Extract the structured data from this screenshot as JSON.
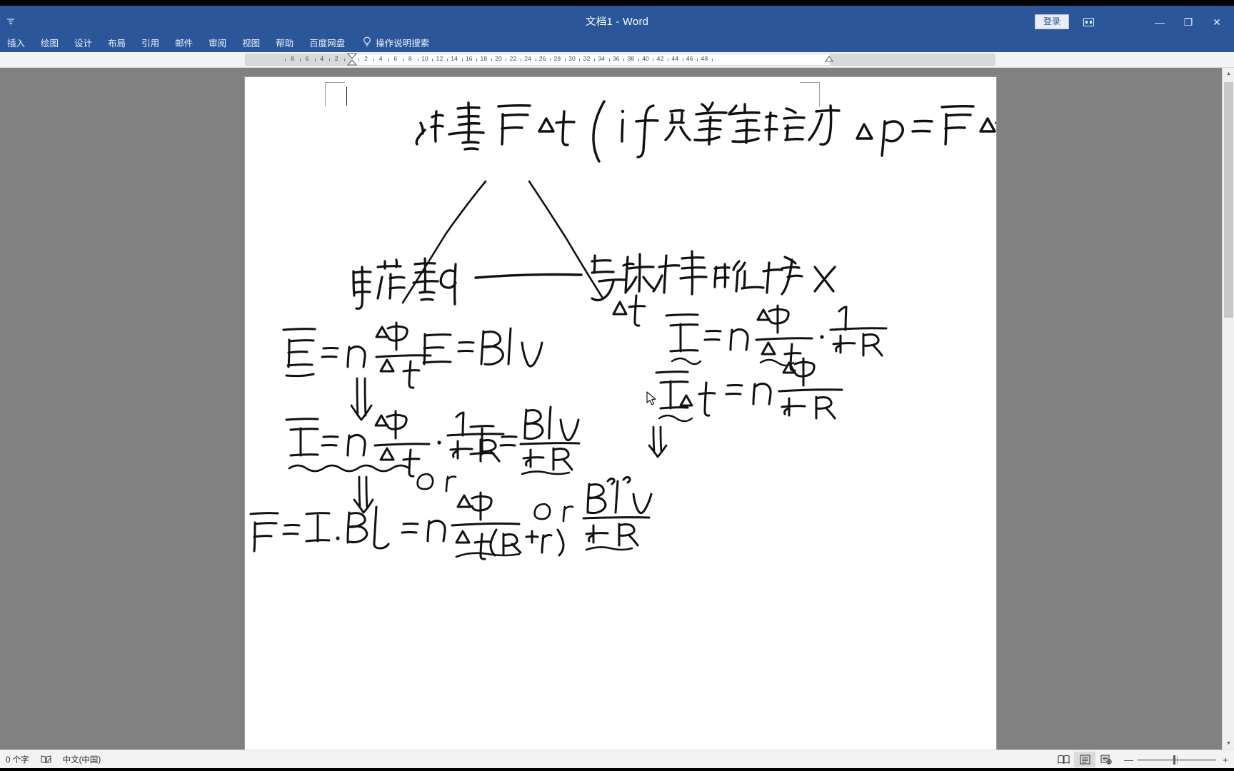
{
  "window": {
    "title": "文档1  -  Word",
    "signin_label": "登录",
    "quick_access_icon": "quick-access-toolbar-icon",
    "ribbon_display_icon": "ribbon-display-options-icon",
    "controls": [
      {
        "name": "minimize",
        "glyph": "—"
      },
      {
        "name": "restore",
        "glyph": "❐"
      },
      {
        "name": "close",
        "glyph": "✕"
      }
    ],
    "accent_color": "#2b579a",
    "titlebar_text_color": "#ffffff"
  },
  "ribbon": {
    "tabs": [
      {
        "label": "插入"
      },
      {
        "label": "绘图"
      },
      {
        "label": "设计"
      },
      {
        "label": "布局"
      },
      {
        "label": "引用"
      },
      {
        "label": "邮件"
      },
      {
        "label": "审阅"
      },
      {
        "label": "视图"
      },
      {
        "label": "帮助"
      },
      {
        "label": "百度网盘"
      }
    ],
    "tellme": {
      "icon": "lightbulb-icon",
      "label": "操作说明搜索"
    }
  },
  "ruler": {
    "labels_left": [
      "8",
      "6",
      "4",
      "2"
    ],
    "labels_right": [
      "2",
      "4",
      "6",
      "8",
      "10",
      "12",
      "14",
      "16",
      "18",
      "20",
      "22",
      "24",
      "26",
      "28",
      "30",
      "32",
      "34",
      "36",
      "38",
      "40",
      "42",
      "44",
      "46",
      "48"
    ],
    "left_indent_marker": "first-line-indent-marker",
    "right_indent_marker": "right-indent-marker"
  },
  "document": {
    "zoom_percent": "100",
    "ink_note_title": "冲量 F̄Δt (if 只受安培力 Δp = F̄Δt)",
    "branch_left": "电荷量 q",
    "branch_right": "导体棒的位移 x",
    "branch_right_sub": "Δt",
    "formulas_left": [
      "Ē = n ΔΦ/Δt",
      "E = Blv",
      "Ī = n ΔΦ/Δt · 1/(R+r)",
      "or",
      "I = Blv/(R+r)",
      "F = I·BL = n ΔΦ/(Δt(R+r))",
      "or",
      "B²l²v/(R+r)"
    ],
    "formulas_right": [
      "Ī = n ΔΦ/Δt · 1/(R+r)",
      "ĪΔt = n ΔΦ/(R+r)"
    ],
    "connector_arrows": [
      "double-down-arrow",
      "double-down-arrow",
      "double-down-arrow"
    ]
  },
  "statusbar": {
    "word_count": "0 个字",
    "proofing_icon": "proofing-errors-icon",
    "language": "中文(中国)",
    "views": [
      {
        "name": "read-mode",
        "icon": "read-mode-icon",
        "active": false
      },
      {
        "name": "print-layout",
        "icon": "print-layout-icon",
        "active": true
      },
      {
        "name": "web-layout",
        "icon": "web-layout-icon",
        "active": false
      }
    ],
    "zoom_out_glyph": "—",
    "zoom_in_glyph": "+"
  }
}
